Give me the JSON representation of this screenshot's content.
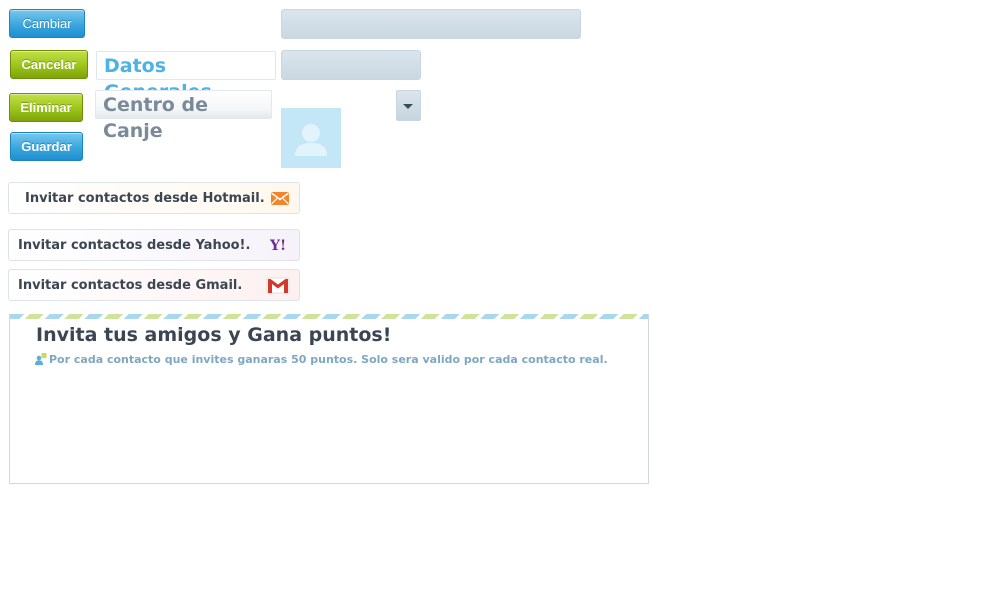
{
  "buttons": {
    "cambiar": "Cambiar",
    "cancelar": "Cancelar",
    "eliminar": "Eliminar",
    "guardar": "Guardar"
  },
  "headings": {
    "datos_generales": "Datos Generales",
    "centro_canje": "Centro de Canje"
  },
  "fields": {
    "wide_input_value": "",
    "short_input_value": "",
    "select_value": ""
  },
  "invite": {
    "hotmail": "Invitar contactos desde Hotmail.",
    "yahoo": "Invitar contactos desde Yahoo!.",
    "gmail": "Invitar contactos desde Gmail."
  },
  "icons": {
    "hotmail": "hotmail-envelope-icon",
    "yahoo": "yahoo-logo-icon",
    "gmail": "gmail-logo-icon",
    "avatar": "user-silhouette-icon",
    "select_arrow": "triangle-down-icon",
    "bullet": "person-bullet-icon"
  },
  "promo": {
    "title": "Invita tus amigos y Gana puntos!",
    "text": "Por cada contacto que invites ganaras 50 puntos. Solo sera valido por cada contacto real."
  },
  "colors": {
    "blue_button": "#3aa6de",
    "green_button": "#9bc41a",
    "heading_blue": "#4db3e4",
    "heading_gray": "#7a8a99",
    "promo_text": "#7ea7c2",
    "title_dark": "#3b4652"
  }
}
